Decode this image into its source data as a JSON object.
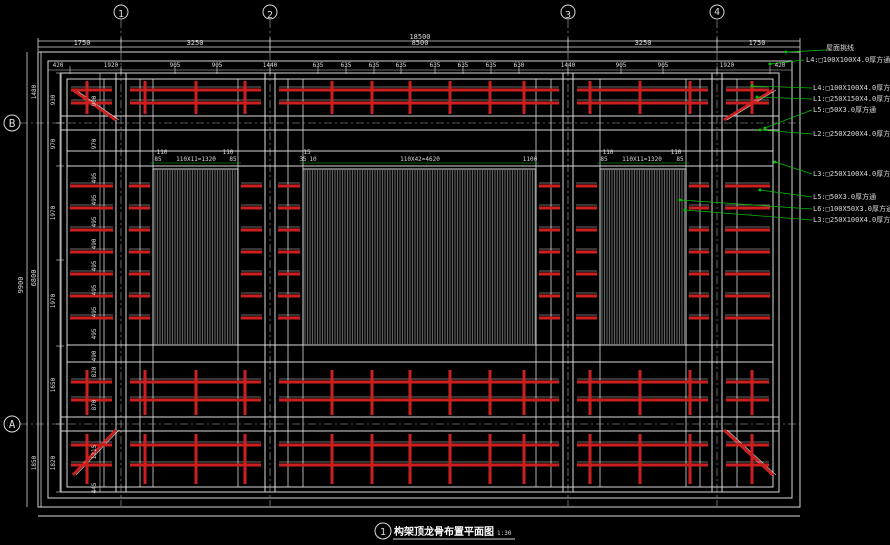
{
  "grid": {
    "columns": [
      "1",
      "2",
      "3",
      "4"
    ],
    "rows": [
      "B",
      "A"
    ]
  },
  "top_dims": {
    "overall": "18500",
    "row1": [
      "1750",
      "3250",
      "8500",
      "3250",
      "1750"
    ],
    "row2": [
      "420",
      "1920",
      "905",
      "905",
      "1440",
      "635",
      "635",
      "635",
      "635",
      "635",
      "635",
      "635",
      "630",
      "1440",
      "905",
      "905",
      "1920",
      "420"
    ]
  },
  "left_dims": {
    "overall": "9900",
    "middle": "6800",
    "left_outer": [
      "1480",
      "1850"
    ],
    "inner": [
      "930",
      "970",
      "1970",
      "1970",
      "1650",
      "1820"
    ],
    "spacing": [
      "900",
      "970",
      "495",
      "495",
      "495",
      "490",
      "495",
      "495",
      "495",
      "495",
      "490",
      "820",
      "870",
      "1215",
      "445"
    ]
  },
  "panel_dims": {
    "left_top": [
      "110",
      "110"
    ],
    "left_small": [
      "85",
      "85"
    ],
    "left_main": "110X11=1320",
    "mid_top": [
      "15",
      "35",
      "10"
    ],
    "mid_main": "110X42=4620",
    "mid_right": "1100",
    "right_top": [
      "110",
      "110"
    ],
    "right_small": [
      "85",
      "85"
    ],
    "right_main": "110X11=1320"
  },
  "legend": [
    "屋面挑线",
    "L4:□100X100X4.0厚方通",
    "L4:□100X100X4.0厚方通",
    "L1:□250X150X4.0厚方通",
    "L5:□50X3.0厚方通",
    "L2:□250X200X4.0厚方通",
    "L3:□250X100X4.0厚方通",
    "L5:□50X3.0厚方通",
    "L6:□100X50X3.0厚方通",
    "L3:□250X100X4.0厚方通"
  ],
  "title": {
    "number": "1",
    "text": "构架顶龙骨布置平面图",
    "scale": "1:30"
  },
  "colors": {
    "background": "#000000",
    "line": "#d9d9d9",
    "accent": "#cc2020",
    "axis": "#b0b0b0",
    "dim": "#00c000"
  }
}
